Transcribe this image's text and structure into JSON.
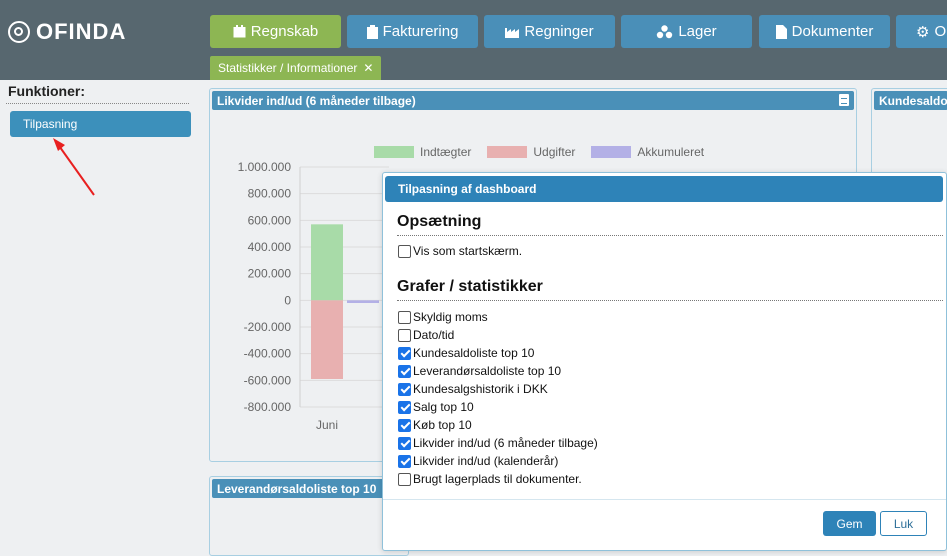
{
  "brand": {
    "name": "OFINDA"
  },
  "nav": [
    {
      "label": "Regnskab",
      "icon": "calendar-icon",
      "active": true
    },
    {
      "label": "Fakturering",
      "icon": "clipboard-icon",
      "active": false
    },
    {
      "label": "Regninger",
      "icon": "factory-icon",
      "active": false
    },
    {
      "label": "Lager",
      "icon": "boxes-icon",
      "active": false
    },
    {
      "label": "Dokumenter",
      "icon": "document-icon",
      "active": false
    },
    {
      "label": "O",
      "icon": "gear-icon",
      "active": false
    }
  ],
  "subtab": {
    "label": "Statistikker / Informationer",
    "close": "✕"
  },
  "sidebar": {
    "title": "Funktioner:",
    "button": "Tilpasning"
  },
  "panels": {
    "liquidity": {
      "title": "Likvider ind/ud (6 måneder tilbage)"
    },
    "customer": {
      "title": "Kundesaldo"
    },
    "supplier": {
      "title": "Leverandørsaldoliste top 10"
    }
  },
  "chart_data": {
    "type": "bar",
    "categories": [
      "Juni"
    ],
    "series": [
      {
        "name": "Indtægter",
        "values": [
          570000
        ],
        "color": "#a8dba8"
      },
      {
        "name": "Udgifter",
        "values": [
          -590000
        ],
        "color": "#e8b0b0"
      },
      {
        "name": "Akkumuleret",
        "values": [
          -20000
        ],
        "color": "#b3b0e6"
      }
    ],
    "yticks": [
      "1.000.000",
      "800.000",
      "600.000",
      "400.000",
      "200.000",
      "0",
      "-200.000",
      "-400.000",
      "-600.000",
      "-800.000"
    ],
    "ylim": [
      -800000,
      1000000
    ],
    "legend": "top",
    "grid": true
  },
  "modal": {
    "title": "Tilpasning af dashboard",
    "section1": "Opsætning",
    "startscreen": {
      "label": "Vis som startskærm.",
      "checked": false
    },
    "section2": "Grafer / statistikker",
    "options": [
      {
        "label": "Skyldig moms",
        "checked": false
      },
      {
        "label": "Dato/tid",
        "checked": false
      },
      {
        "label": "Kundesaldoliste top 10",
        "checked": true
      },
      {
        "label": "Leverandørsaldoliste top 10",
        "checked": true
      },
      {
        "label": "Kundesalgshistorik i DKK",
        "checked": true
      },
      {
        "label": "Salg top 10",
        "checked": true
      },
      {
        "label": "Køb top 10",
        "checked": true
      },
      {
        "label": "Likvider ind/ud (6 måneder tilbage)",
        "checked": true
      },
      {
        "label": "Likvider ind/ud (kalenderår)",
        "checked": true
      },
      {
        "label": "Brugt lagerplads til dokumenter.",
        "checked": false
      }
    ],
    "save": "Gem",
    "close": "Luk"
  }
}
